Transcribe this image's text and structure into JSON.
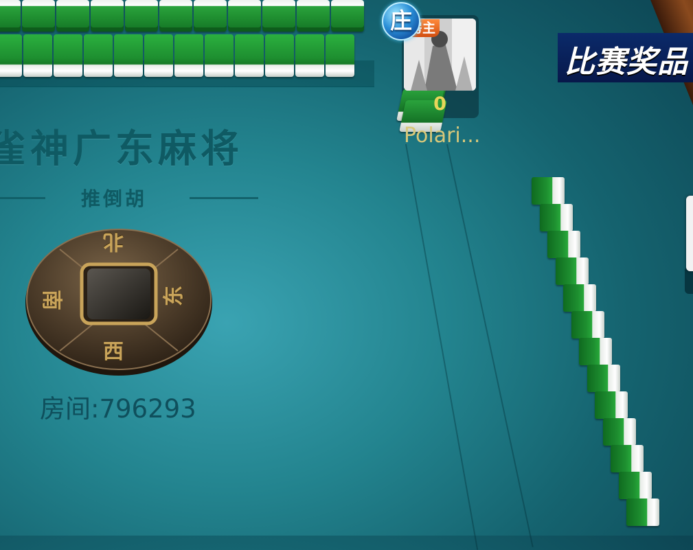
{
  "game": {
    "title": "雀神广东麻将",
    "subtitle": "推倒胡",
    "room_label": "房间:796293"
  },
  "compass": {
    "north": "北",
    "south": "南",
    "east": "东",
    "west": "西"
  },
  "player": {
    "host_badge": "房主",
    "dealer_badge": "庄",
    "score": "0",
    "name": "Polari..."
  },
  "prize_button": {
    "label": "比赛奖品"
  },
  "colors": {
    "felt": "#23848f",
    "tile_back": "#1e8f30",
    "text_dark": "#0f5a63",
    "score_yellow": "#e8d55a"
  }
}
